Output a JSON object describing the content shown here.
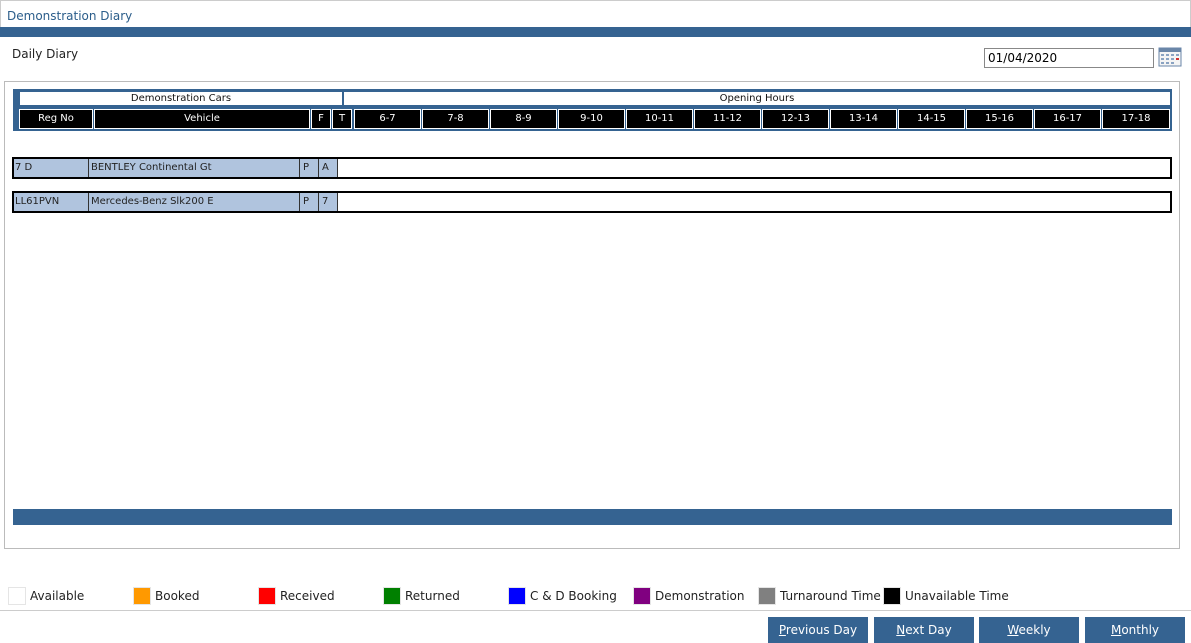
{
  "window": {
    "title": "Demonstration Diary"
  },
  "toolbar": {
    "daily_label": "Daily Diary",
    "date_value": "01/04/2020"
  },
  "grid": {
    "groups": [
      "Demonstration Cars",
      "Opening Hours"
    ],
    "columns": [
      "Reg No",
      "Vehicle",
      "F",
      "T",
      "6-7",
      "7-8",
      "8-9",
      "9-10",
      "10-11",
      "11-12",
      "12-13",
      "13-14",
      "14-15",
      "15-16",
      "16-17",
      "17-18"
    ],
    "rows": [
      {
        "reg": "7 D",
        "vehicle": "BENTLEY Continental Gt",
        "f": "P",
        "t": "A"
      },
      {
        "reg": "LL61PVN",
        "vehicle": "Mercedes-Benz Slk200 E",
        "f": "P",
        "t": "7"
      }
    ]
  },
  "legend": [
    {
      "label": "Available",
      "color": "#ffffff"
    },
    {
      "label": "Booked",
      "color": "#ff9900"
    },
    {
      "label": "Received",
      "color": "#ff0000"
    },
    {
      "label": "Returned",
      "color": "#008000"
    },
    {
      "label": "C & D Booking",
      "color": "#0000ff"
    },
    {
      "label": "Demonstration",
      "color": "#800080"
    },
    {
      "label": "Turnaround Time",
      "color": "#808080"
    },
    {
      "label": "Unavailable Time",
      "color": "#000000"
    }
  ],
  "nav": {
    "previous_first": "P",
    "previous_rest": "revious Day",
    "next_first": "N",
    "next_rest": "ext Day",
    "weekly_first": "W",
    "weekly_rest": "eekly",
    "monthly_first": "M",
    "monthly_rest": "onthly"
  },
  "colors": {
    "accent": "#356391",
    "row_cell": "#b0c4de",
    "header_cell": "#000000"
  }
}
